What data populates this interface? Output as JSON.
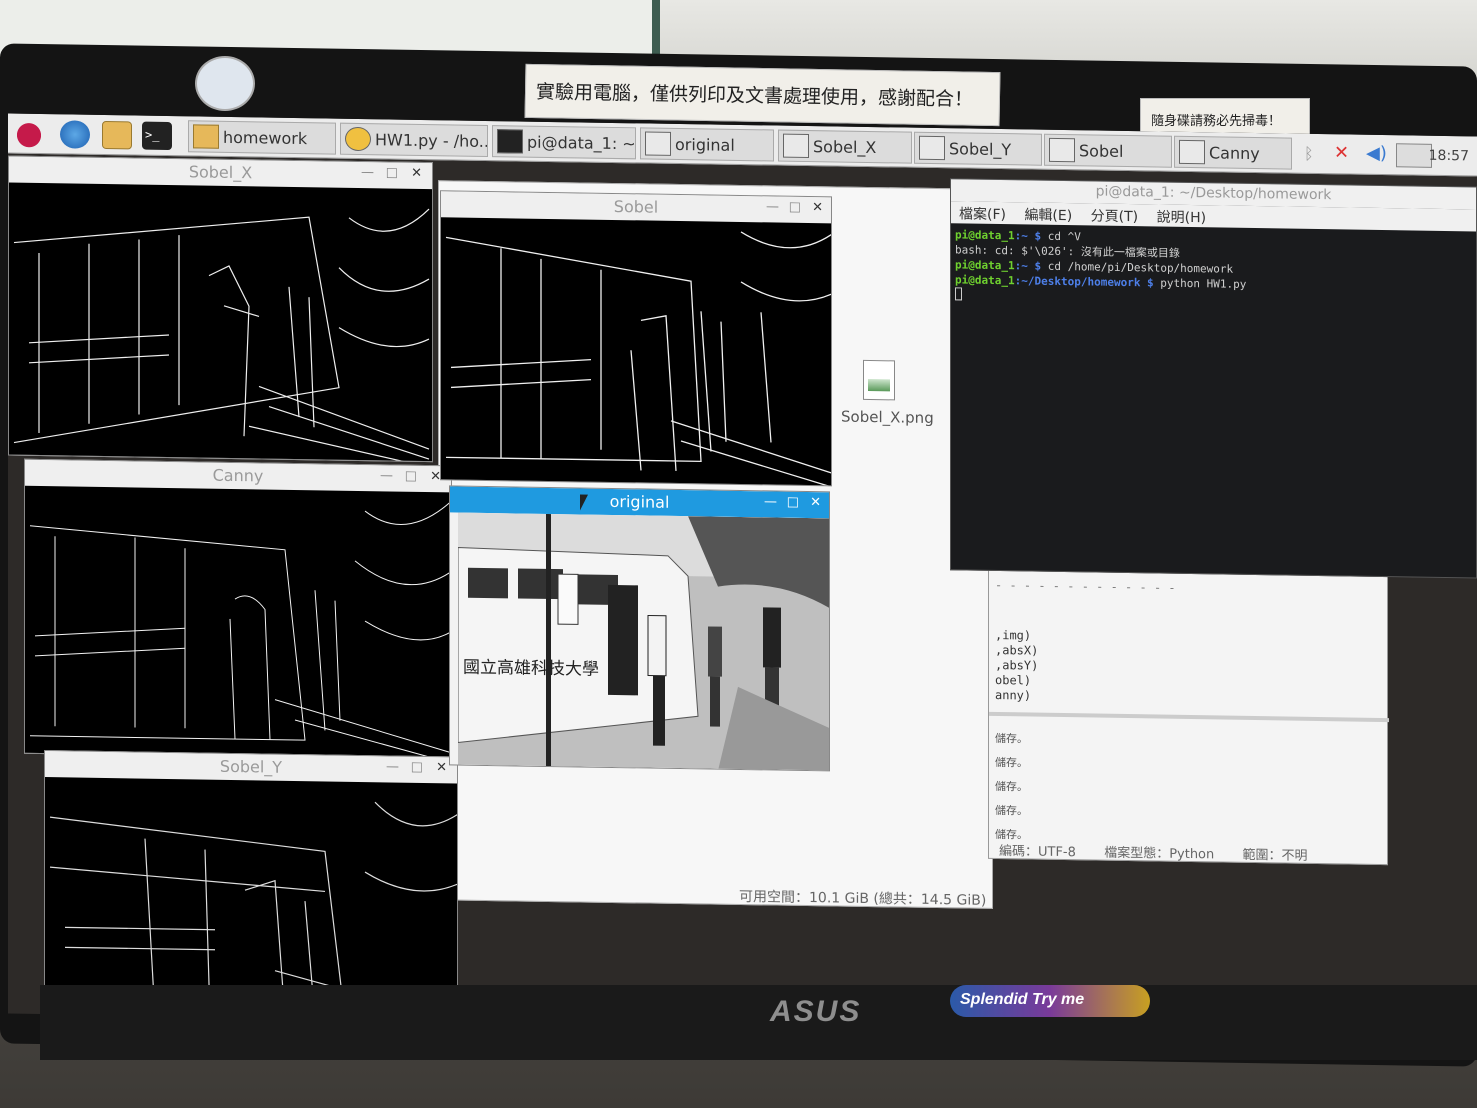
{
  "stickers": {
    "top": "實驗用電腦，僅供列印及文書處理使用，感謝配合！",
    "right": "隨身碟請務必先掃毒！"
  },
  "taskbar": {
    "buttons": [
      {
        "label": "homework"
      },
      {
        "label": "HW1.py - /ho..."
      },
      {
        "label": "pi@data_1: ~..."
      },
      {
        "label": "original"
      },
      {
        "label": "Sobel_X"
      },
      {
        "label": "Sobel_Y"
      },
      {
        "label": "Sobel"
      },
      {
        "label": "Canny"
      }
    ],
    "clock": "18:57"
  },
  "windows": {
    "sobel_x": {
      "title": "Sobel_X"
    },
    "sobel": {
      "title": "Sobel"
    },
    "canny": {
      "title": "Canny"
    },
    "original": {
      "title": "original"
    },
    "sobel_y": {
      "title": "Sobel_Y"
    }
  },
  "terminal": {
    "title": "pi@data_1: ~/Desktop/homework",
    "menu": [
      "檔案(F)",
      "編輯(E)",
      "分頁(T)",
      "說明(H)"
    ],
    "lines": [
      {
        "prompt": "pi@data_1",
        "path": ":~ $",
        "cmd": " cd ^V"
      },
      {
        "prompt": "",
        "path": "",
        "cmd": "bash: cd: $'\\026': 沒有此一檔案或目錄"
      },
      {
        "prompt": "pi@data_1",
        "path": ":~ $",
        "cmd": " cd /home/pi/Desktop/homework"
      },
      {
        "prompt": "pi@data_1",
        "path": ":~/Desktop/homework $",
        "cmd": " python HW1.py"
      }
    ]
  },
  "file_manager": {
    "file_name": "Sobel_X.png",
    "status": "可用空間：10.1 GiB (總共：14.5 GiB)"
  },
  "editor": {
    "code_lines": [
      ",img)",
      ",absX)",
      ",absY)",
      "obel)",
      "anny)"
    ],
    "log_lines": [
      "儲存。",
      "儲存。",
      "儲存。",
      "儲存。",
      "儲存。"
    ],
    "status": {
      "encoding": "編碼：UTF-8",
      "filetype": "檔案型態：Python",
      "range": "範圍：不明"
    }
  },
  "bezel": {
    "brand": "ASUS",
    "splendid": "Splendid Try me"
  },
  "colors": {
    "active_title": "#1f9ae0",
    "prompt_green": "#6fd12f",
    "path_blue": "#4d7fe8"
  }
}
